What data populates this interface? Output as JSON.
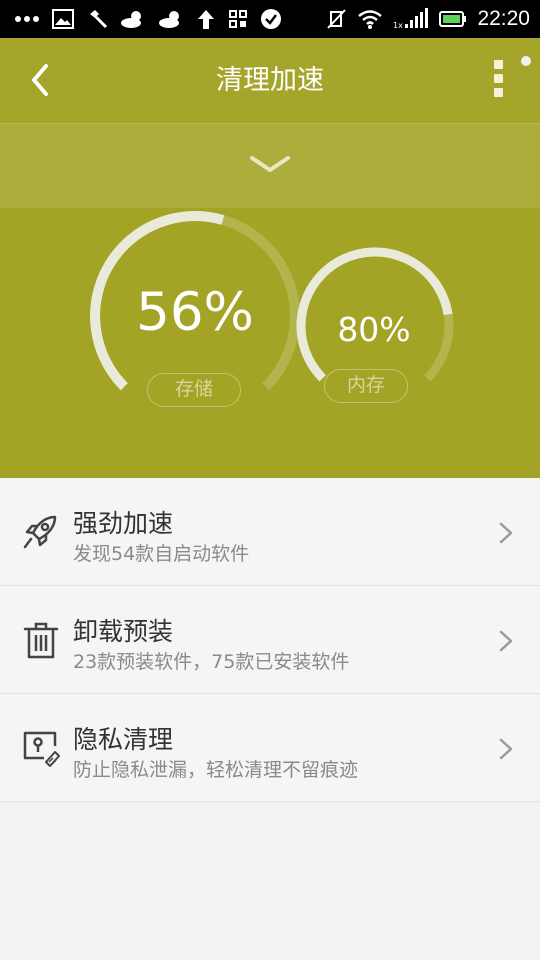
{
  "status_bar": {
    "time": "22:20",
    "icons": [
      "more-dots-icon",
      "image-icon",
      "tool-icon",
      "cloud-sun-icon",
      "cloud-sun-icon",
      "upload-arrow-icon",
      "app-grid-icon",
      "check-circle-icon",
      "mute-icon",
      "wifi-icon",
      "signal-icon",
      "battery-icon"
    ]
  },
  "header": {
    "title": "清理加速",
    "back_icon": "back-arrow-icon",
    "menu_icon": "overflow-menu-icon",
    "background": "#a4a52a"
  },
  "expand_bar": {
    "icon": "chevron-down-icon"
  },
  "gauges": {
    "storage": {
      "value_text": "56%",
      "percent": 56,
      "label": "存储"
    },
    "memory": {
      "value_text": "80%",
      "percent": 80,
      "label": "内存"
    }
  },
  "list": {
    "items": [
      {
        "icon": "rocket-icon",
        "title": "强劲加速",
        "subtitle": "发现54款自启动软件"
      },
      {
        "icon": "trash-icon",
        "title": "卸载预装",
        "subtitle": "23款预装软件，75款已安装软件"
      },
      {
        "icon": "privacy-clean-icon",
        "title": "隐私清理",
        "subtitle": "防止隐私泄漏，轻松清理不留痕迹"
      }
    ]
  },
  "colors": {
    "accent": "#a3a425",
    "accent_light": "#acad3b",
    "list_bg": "#f5f5f5",
    "page_bg": "#f2f2f4"
  }
}
